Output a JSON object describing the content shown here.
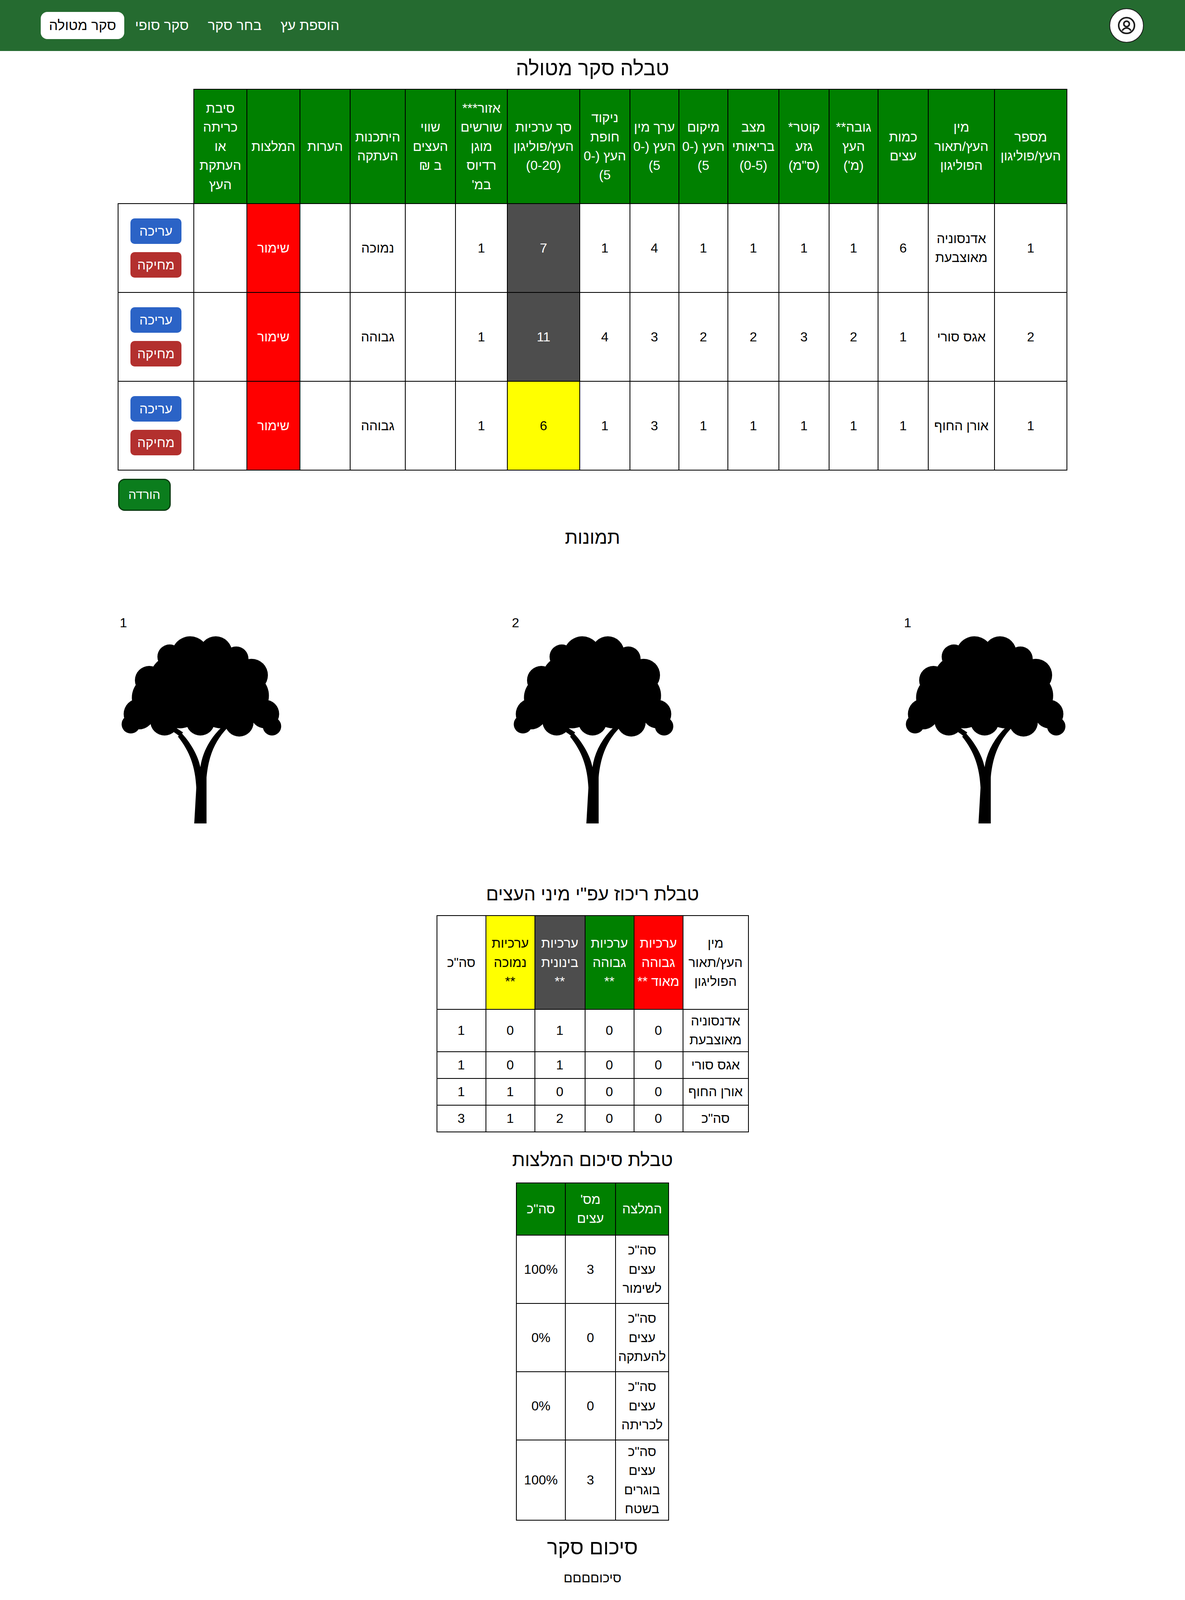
{
  "nav": {
    "items": [
      {
        "label": "הוספת עץ",
        "selected": false
      },
      {
        "label": "בחר סקר",
        "selected": false
      },
      {
        "label": "סקר סופי",
        "selected": false
      },
      {
        "label": "סקר מטולה",
        "selected": true
      }
    ]
  },
  "title": "טבלה סקר מטולה",
  "table": {
    "columns": [
      "מספר העץ/פוליגון",
      "מין העץ/תאור הפוליגון",
      "כמות עצים",
      "גובה** העץ (מ')",
      "קוטר* גזע (ס\"מ)",
      "מצב בריאותי (0-5)",
      "מיקום העץ (0-5)",
      "ערך מין העץ (0-5)",
      "ניקוד חופת העץ (0-5)",
      "סך ערכיות העץ/פוליגון (0-20)",
      "אזור*** שורשים מוגן רדיוס במ'",
      "שווי העצים ב ₪",
      "היתכנות העתקה",
      "הערות",
      "המלצות",
      "סיבת כריתה או העתקת העץ"
    ],
    "actions": [
      {
        "label": "עריכה",
        "color": "#2b63c6"
      },
      {
        "label": "מחיקה",
        "color": "#b3302e"
      }
    ],
    "rows": [
      {
        "cells": [
          "1",
          "אדנסוניה מאוצבעת",
          "6",
          "1",
          "1",
          "1",
          "1",
          "4",
          "1",
          "7",
          "1",
          "",
          "נמוכה",
          "",
          "שימור",
          ""
        ],
        "score_color": "#4d4d4d",
        "recommendation_color": "#ff0000"
      },
      {
        "cells": [
          "2",
          "אגס סורי",
          "1",
          "2",
          "3",
          "2",
          "2",
          "3",
          "4",
          "11",
          "1",
          "",
          "גבוהה",
          "",
          "שימור",
          ""
        ],
        "score_color": "#4d4d4d",
        "recommendation_color": "#ff0000"
      },
      {
        "cells": [
          "1",
          "אורן החוף",
          "1",
          "1",
          "1",
          "1",
          "1",
          "3",
          "1",
          "6",
          "1",
          "",
          "גבוהה",
          "",
          "שימור",
          ""
        ],
        "score_color": "#ffff00",
        "recommendation_color": "#ff0000"
      }
    ]
  },
  "download": "הורדה",
  "photos": {
    "title": "תמונות",
    "items": [
      {
        "label": "1"
      },
      {
        "label": "2"
      },
      {
        "label": "1"
      }
    ]
  },
  "species_summary": {
    "title": "טבלת ריכוז עפ\"י מיני העצים",
    "columns": [
      {
        "label": "מין העץ/תאור הפוליגון",
        "color": "#ffffff"
      },
      {
        "label": "ערכיות גבוהה מאוד **",
        "color": "#ff0000"
      },
      {
        "label": "ערכיות גבוהה **",
        "color": "#008000"
      },
      {
        "label": "ערכיות בינונית **",
        "color": "#4d4d4d"
      },
      {
        "label": "ערכיות נמוכה **",
        "color": "#ffff00"
      },
      {
        "label": "סה\"כ",
        "color": "#ffffff"
      }
    ],
    "rows": [
      [
        "אדנסוניה מאוצבעת",
        "0",
        "0",
        "1",
        "0",
        "1"
      ],
      [
        "אגס סורי",
        "0",
        "0",
        "1",
        "0",
        "1"
      ],
      [
        "אורן החוף",
        "0",
        "0",
        "0",
        "1",
        "1"
      ],
      [
        "סה\"כ",
        "0",
        "0",
        "2",
        "1",
        "3"
      ]
    ]
  },
  "recommendations": {
    "title": "טבלת סיכום המלצות",
    "columns": [
      "המלצה",
      "מס' עצים",
      "סה\"כ"
    ],
    "rows": [
      [
        "סה\"כ עצים לשימור",
        "3",
        "100%"
      ],
      [
        "סה\"כ עצים להעתקה",
        "0",
        "0%"
      ],
      [
        "סה\"כ עצים לכריתה",
        "0",
        "0%"
      ],
      [
        "סה\"כ עצים בוגרים בשטח",
        "3",
        "100%"
      ]
    ]
  },
  "survey_summary": {
    "title": "סיכום סקר",
    "text": "סיכוםםםם"
  }
}
